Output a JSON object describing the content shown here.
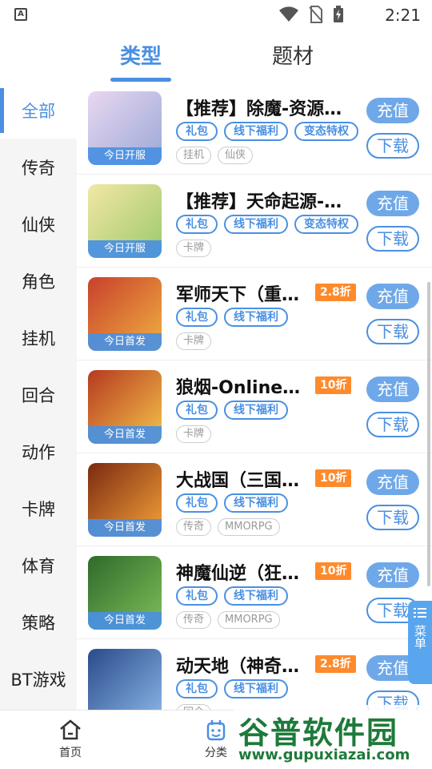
{
  "status_bar": {
    "time": "2:21",
    "app_icon_letter": "A"
  },
  "top_tabs": [
    {
      "label": "类型",
      "active": true
    },
    {
      "label": "题材",
      "active": false
    }
  ],
  "sidebar": {
    "items": [
      {
        "label": "全部",
        "active": true
      },
      {
        "label": "传奇"
      },
      {
        "label": "仙侠"
      },
      {
        "label": "角色"
      },
      {
        "label": "挂机"
      },
      {
        "label": "回合"
      },
      {
        "label": "动作"
      },
      {
        "label": "卡牌"
      },
      {
        "label": "体育"
      },
      {
        "label": "策略"
      },
      {
        "label": "BT游戏"
      }
    ]
  },
  "games": [
    {
      "title": "【推荐】除魔-资源…",
      "badge": "今日开服",
      "discount": "",
      "tags": [
        "礼包",
        "线下福利",
        "变态特权"
      ],
      "subtags": [
        "挂机",
        "仙侠"
      ],
      "charge": "充值",
      "download": "下载",
      "icon_colors": [
        "#e9d7f0",
        "#9aa8d8"
      ]
    },
    {
      "title": "【推荐】天命起源-…",
      "badge": "今日开服",
      "discount": "",
      "tags": [
        "礼包",
        "线下福利",
        "变态特权"
      ],
      "subtags": [
        "卡牌"
      ],
      "charge": "充值",
      "download": "下载",
      "icon_colors": [
        "#f3e7a6",
        "#9bc96a"
      ]
    },
    {
      "title": "军师天下（重…",
      "badge": "今日首发",
      "discount": "2.8折",
      "tags": [
        "礼包",
        "线下福利"
      ],
      "subtags": [
        "卡牌"
      ],
      "charge": "充值",
      "download": "下载",
      "icon_colors": [
        "#c8402c",
        "#f0b040"
      ]
    },
    {
      "title": "狼烟-Online（…",
      "badge": "今日首发",
      "discount": "10折",
      "tags": [
        "礼包",
        "线下福利"
      ],
      "subtags": [
        "卡牌"
      ],
      "charge": "充值",
      "download": "下载",
      "icon_colors": [
        "#b53a1f",
        "#f5c44a"
      ]
    },
    {
      "title": "大战国（三国…",
      "badge": "今日首发",
      "discount": "10折",
      "tags": [
        "礼包",
        "线下福利"
      ],
      "subtags": [
        "传奇",
        "MMORPG"
      ],
      "charge": "充值",
      "download": "下载",
      "icon_colors": [
        "#7a2a10",
        "#f7a23a"
      ]
    },
    {
      "title": "神魔仙逆（狂…",
      "badge": "今日首发",
      "discount": "10折",
      "tags": [
        "礼包",
        "线下福利"
      ],
      "subtags": [
        "传奇",
        "MMORPG"
      ],
      "charge": "充值",
      "download": "下载",
      "icon_colors": [
        "#2f6a2a",
        "#7fbf5a"
      ]
    },
    {
      "title": "动天地（神奇…",
      "badge": "",
      "discount": "2.8折",
      "tags": [
        "礼包",
        "线下福利"
      ],
      "subtags": [
        "回合"
      ],
      "charge": "充值",
      "download": "下载",
      "icon_colors": [
        "#2a4a8a",
        "#8cb8e8"
      ]
    }
  ],
  "menu_float": "菜单",
  "bottom_nav": [
    {
      "label": "首页",
      "icon": "home-icon"
    },
    {
      "label": "分类",
      "icon": "category-icon"
    }
  ],
  "watermark": {
    "main": "谷普软件园",
    "url": "www.gupuxiazai.com"
  },
  "colors": {
    "accent": "#4a90e2",
    "discount": "#ff8a2b"
  }
}
